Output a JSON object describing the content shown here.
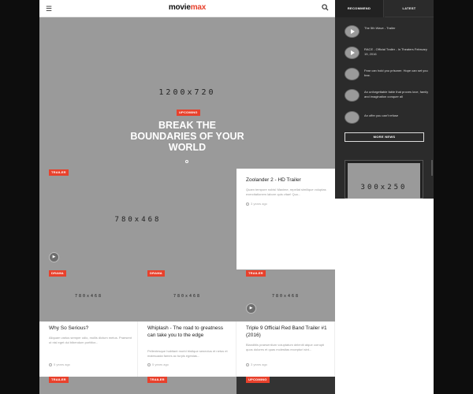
{
  "header": {
    "menu_icon": "hamburger-icon",
    "logo_part1": "movie",
    "logo_part2": "max",
    "search_icon": "search-icon"
  },
  "hero": {
    "placeholder": "1200x720",
    "badge": "UPCOMING",
    "title_line1": "BREAK THE",
    "title_line2": "BOUNDARIES OF YOUR",
    "title_line3": "WORLD"
  },
  "featured": {
    "badge": "TRAILER",
    "placeholder": "780x468",
    "title": "Zoolander 2 - HD Trailer",
    "excerpt": "Quam tempore nobis! Maxime, repellat similique voluptas exercitationem labore quis vitae! Quo...",
    "meta": "3 years ago"
  },
  "cards": [
    {
      "badge": "DRAMA",
      "placeholder": "780x468",
      "title": "Why So Serious?",
      "excerpt": "Aliquam varius semper odio, mollis dictum metus. Praesent ut nisl eget dui bibendum porttitor...",
      "meta": "5 years ago",
      "has_play": false
    },
    {
      "badge": "DRAMA",
      "placeholder": "780x468",
      "title": "Whiplash - The road to greatness can take you to the edge",
      "excerpt": "Pellentesque habitant morbi tristique senectus et netus et malesuada fames ac turpis egestas...",
      "meta": "5 years ago",
      "has_play": false
    },
    {
      "badge": "TRAILER",
      "placeholder": "780x468",
      "title": "Triple 9 Official Red Band Trailer #1 (2016)",
      "excerpt": "Blanditiis praesentium voluptatum deleniti atque corrupti quos dolores et quas molestias excepturi sint...",
      "meta": "3 years ago",
      "has_play": true
    }
  ],
  "bottom_badges": [
    "TRAILER",
    "TRAILER",
    "UPCOMING"
  ],
  "sidebar": {
    "tabs": [
      "RECOMMEND",
      "LATEST"
    ],
    "items": [
      {
        "title": "The 5th Wave - Trailer"
      },
      {
        "title": "RACE - Official Trailer - In Theaters February 19, 2016"
      },
      {
        "title": "Fear can hold you prisoner. Hope can set you free."
      },
      {
        "title": "An unforgettable fable that proves love, family and imagination conquer all"
      },
      {
        "title": "An offer you can't refuse"
      }
    ],
    "more_button": "MORE NEWS",
    "ad_placeholder": "300x250"
  },
  "colors": {
    "accent": "#e8412c",
    "placeholder": "#9a9a9a",
    "sidebar_bg": "#2b2b2b"
  }
}
